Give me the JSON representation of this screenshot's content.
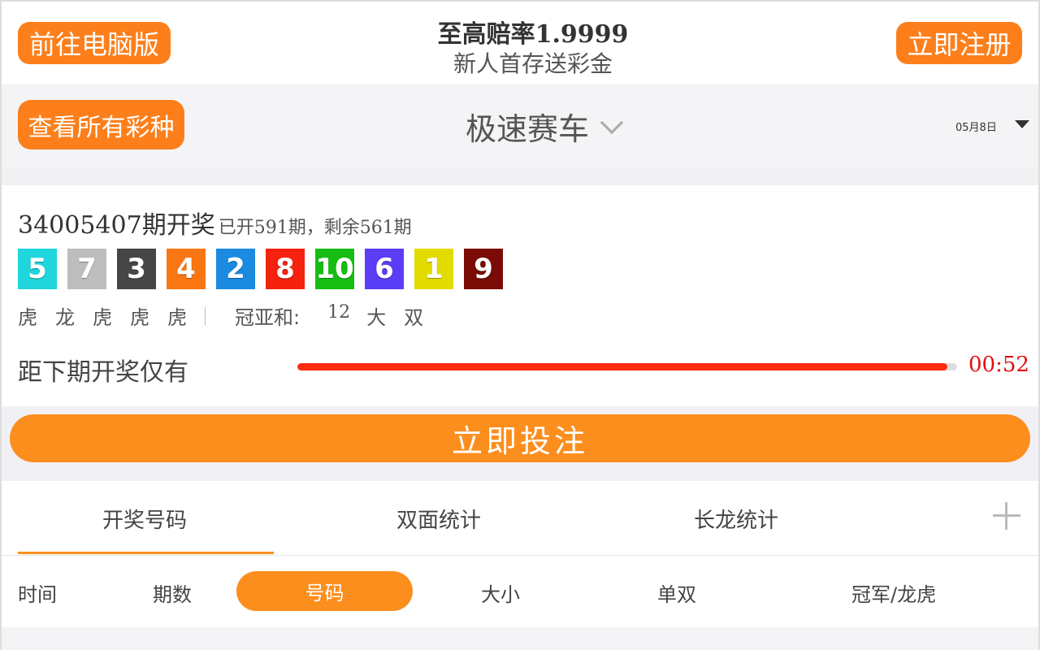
{
  "header": {
    "pc_button": "前往电脑版",
    "promo_title": "至高赔率1.9999",
    "promo_subtitle": "新人首存送彩金",
    "register_button": "立即注册"
  },
  "subheader": {
    "all_lotteries_button": "查看所有彩种",
    "game_title": "极速赛车",
    "date": "05月8日"
  },
  "draw": {
    "issue": "34005407期开奖",
    "progress_text": "已开591期，剩余561期",
    "balls": [
      {
        "number": "5",
        "color": "#1ed6dc"
      },
      {
        "number": "7",
        "color": "#bdbdbd"
      },
      {
        "number": "3",
        "color": "#464646"
      },
      {
        "number": "4",
        "color": "#f97613"
      },
      {
        "number": "2",
        "color": "#1a8be0"
      },
      {
        "number": "8",
        "color": "#f5220f"
      },
      {
        "number": "10",
        "color": "#16bd13"
      },
      {
        "number": "6",
        "color": "#5a3ef5"
      },
      {
        "number": "1",
        "color": "#e2db00"
      },
      {
        "number": "9",
        "color": "#7a0b06"
      }
    ],
    "dragon_tiger": [
      "虎",
      "龙",
      "虎",
      "虎",
      "虎"
    ],
    "sum_label": "冠亚和:",
    "sum_value": "12",
    "sum_size": "大",
    "sum_parity": "双",
    "countdown_label": "距下期开奖仅有",
    "countdown_time": "00:52",
    "countdown_fraction": 0.985
  },
  "bet_button": "立即投注",
  "tabs": [
    "开奖号码",
    "双面统计",
    "长龙统计"
  ],
  "filters": {
    "time": "时间",
    "issue": "期数",
    "number": "号码",
    "size": "大小",
    "parity": "单双",
    "champion": "冠军/龙虎"
  }
}
